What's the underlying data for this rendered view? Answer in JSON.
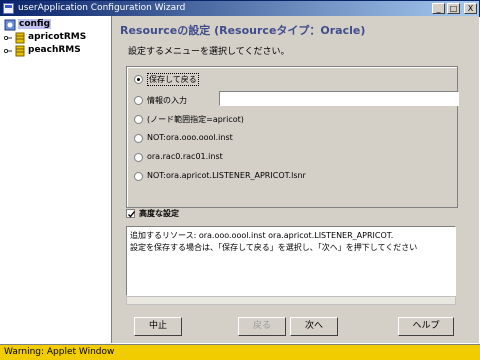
{
  "window": {
    "title": "userApplication Configuration Wizard",
    "buttons": [
      "_",
      "□",
      "X"
    ]
  },
  "tree": {
    "root": "config",
    "children": [
      "apricotRMS",
      "peachRMS"
    ]
  },
  "main": {
    "heading": "Resourceの設定 (Resourceタイプ：Oracle)",
    "subtitle": "設定するメニューを選択してください。",
    "options": [
      {
        "label": "保存して戻る",
        "selected": true
      },
      {
        "label": "情報の入力",
        "selected": false,
        "input_value": ""
      },
      {
        "label": "(ノード範囲指定=apricot)",
        "selected": false
      },
      {
        "label": "NOT:ora.ooo.oool.inst",
        "selected": false
      },
      {
        "label": "ora.rac0.rac01.inst",
        "selected": false
      },
      {
        "label": "NOT:ora.apricot.LISTENER_APRICOT.lsnr",
        "selected": false
      }
    ],
    "advanced": {
      "label": "高度な設定",
      "checked": true
    },
    "info_lines": [
      "追加するリソース: ora.ooo.oool.inst ora.apricot.LISTENER_APRICOT.",
      "設定を保存する場合は、「保存して戻る」を選択し、「次へ」を押下してください"
    ],
    "buttons": {
      "cancel": "中止",
      "back": "戻る",
      "next": "次へ",
      "help": "ヘルプ"
    }
  },
  "status": {
    "text": "Warning: Applet Window"
  },
  "colors": {
    "heading": "#404c8c",
    "status_bar": "#f0cc00",
    "titlebar": "#0a246a"
  }
}
